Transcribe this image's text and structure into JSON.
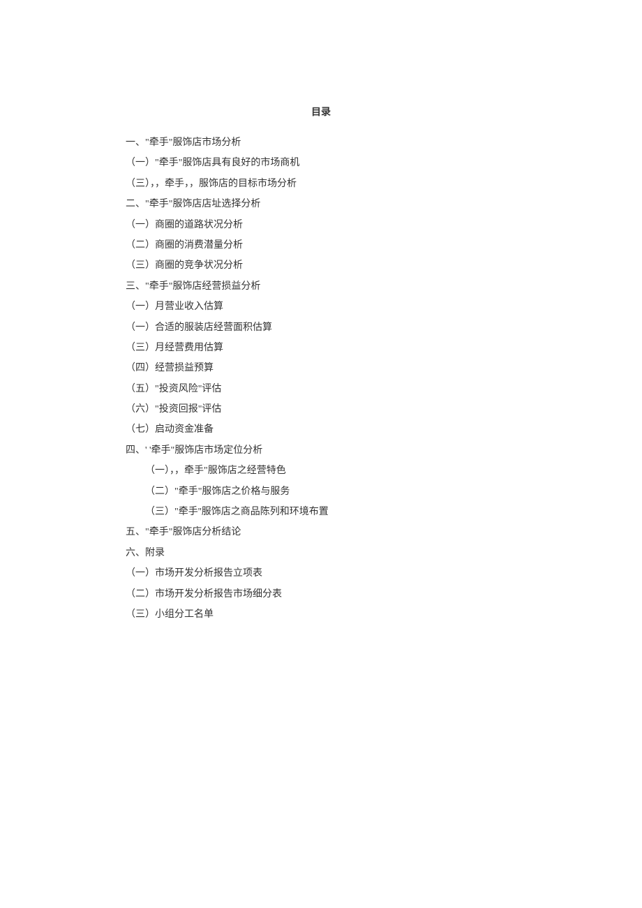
{
  "title": "目录",
  "toc": [
    {
      "text": "一、\"牵手\"服饰店市场分析",
      "indent": false
    },
    {
      "text": "（一）\"牵手\"服饰店具有良好的市场商机",
      "indent": false
    },
    {
      "text": "（三），，牵手，，服饰店的目标市场分析",
      "indent": false
    },
    {
      "text": "二、\"牵手\"服饰店店址选择分析",
      "indent": false
    },
    {
      "text": "（一）商圈的道路状况分析",
      "indent": false
    },
    {
      "text": "（二）商圈的消费潜量分析",
      "indent": false
    },
    {
      "text": "（三）商圈的竞争状况分析",
      "indent": false
    },
    {
      "text": "三、\"牵手\"服饰店经营损益分析",
      "indent": false
    },
    {
      "text": "（一）月营业收入估算",
      "indent": false
    },
    {
      "text": "（一）合适的服装店经营面积估算",
      "indent": false
    },
    {
      "text": "（三）月经营费用估算",
      "indent": false
    },
    {
      "text": "（四）经营损益预算",
      "indent": false
    },
    {
      "text": "（五）\"投资风险\"评估",
      "indent": false
    },
    {
      "text": "（六）\"投资回报\"评估",
      "indent": false
    },
    {
      "text": "（七）启动资金准备",
      "indent": false
    },
    {
      "text": "四、' '牵手\"服饰店市场定位分析",
      "indent": false
    },
    {
      "text": "（一），，牵手\"服饰店之经营特色",
      "indent": true
    },
    {
      "text": "（二）\"牵手\"服饰店之价格与服务",
      "indent": true
    },
    {
      "text": "（三）\"牵手''服饰店之商品陈列和环境布置",
      "indent": true
    },
    {
      "text": "五、\"牵手\"服饰店分析结论",
      "indent": false
    },
    {
      "text": "六、附录",
      "indent": false
    },
    {
      "text": "（一）市场开发分析报告立项表",
      "indent": false
    },
    {
      "text": "（二）市场开发分析报告市场细分表",
      "indent": false
    },
    {
      "text": "（三）小组分工名单",
      "indent": false
    }
  ]
}
